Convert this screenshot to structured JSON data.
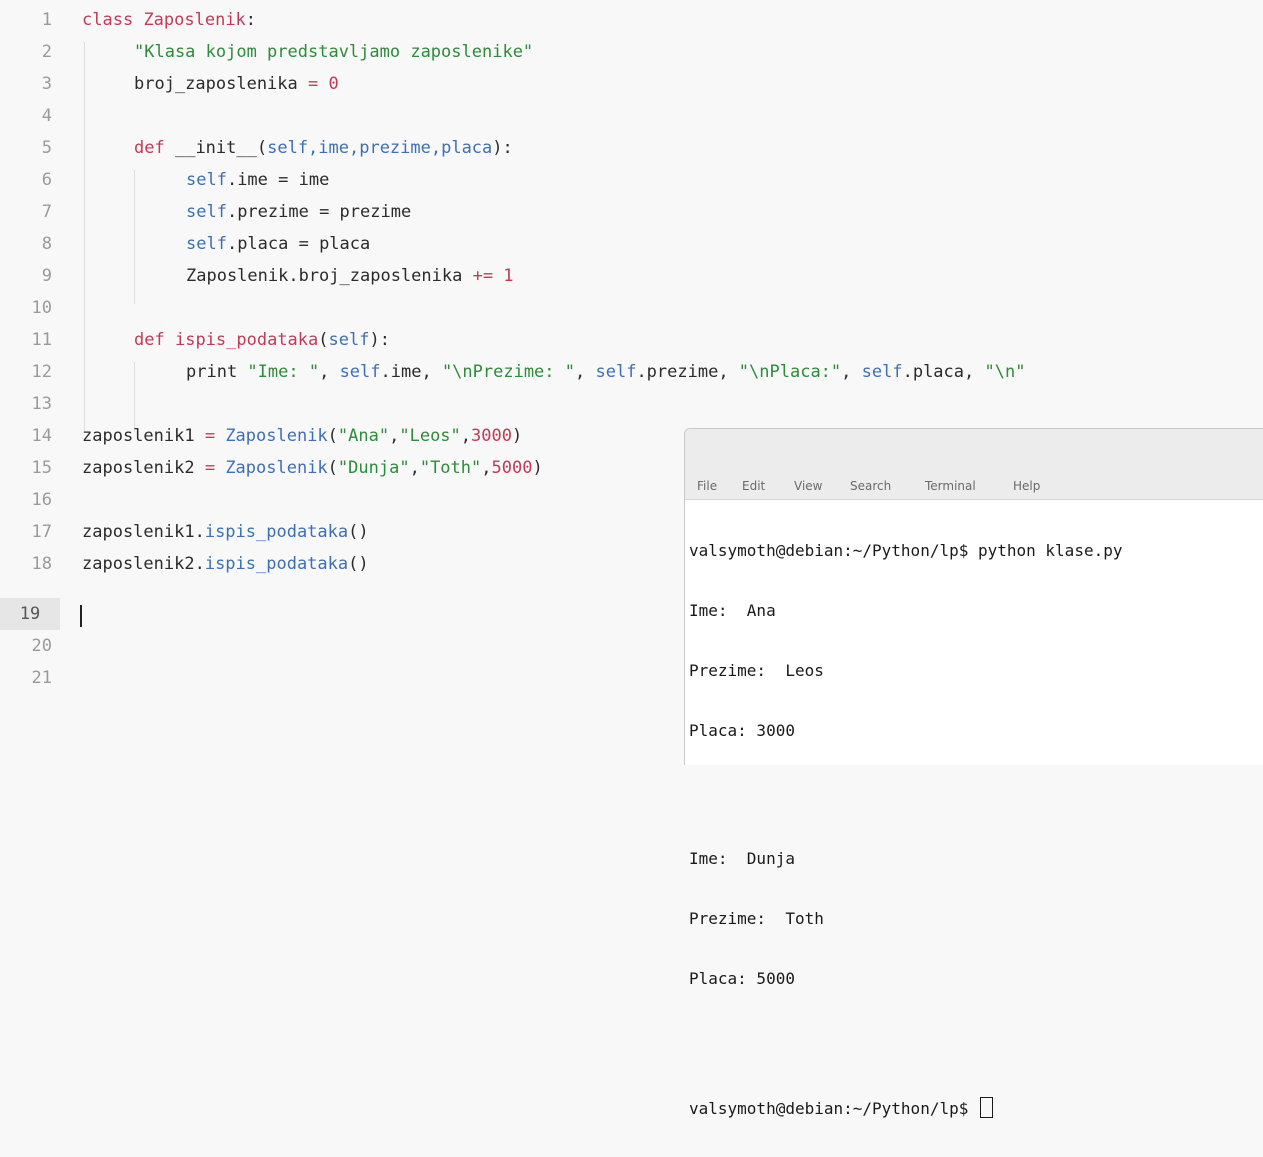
{
  "editor": {
    "line_numbers": [
      "1",
      "2",
      "3",
      "4",
      "5",
      "6",
      "7",
      "8",
      "9",
      "10",
      "11",
      "12",
      "13",
      "14",
      "15",
      "16",
      "17",
      "18",
      "19",
      "20",
      "21"
    ],
    "current_line": "19",
    "code": {
      "l1_kw": "class",
      "l1_cls": "Zaposlenik",
      "l1_colon": ":",
      "l2_str": "\"Klasa kojom predstavljamo zaposlenike\"",
      "l3_var": "broj_zaposlenika",
      "l3_op": " = ",
      "l3_num": "0",
      "l5_kw": "def",
      "l5_fn": "__init__",
      "l5_open": "(",
      "l5_params": "self,ime,prezime,placa",
      "l5_close": "):",
      "l6_self": "self",
      "l6_rest": ".ime = ime",
      "l7_self": "self",
      "l7_rest": ".prezime = prezime",
      "l8_self": "self",
      "l8_rest": ".placa = placa",
      "l9_a": "Zaposlenik.broj_zaposlenika ",
      "l9_op": "+=",
      "l9_num": " 1",
      "l11_kw": "def",
      "l11_fn": "ispis_podataka",
      "l11_open": "(",
      "l11_self": "self",
      "l11_close": "):",
      "l12_print": "print ",
      "l12_s1": "\"Ime: \"",
      "l12_c1": ", ",
      "l12_self1": "self",
      "l12_r1": ".ime, ",
      "l12_s2": "\"\\nPrezime: \"",
      "l12_c2": ", ",
      "l12_self2": "self",
      "l12_r2": ".prezime, ",
      "l12_s3": "\"\\nPlaca:\"",
      "l12_c3": ", ",
      "l12_self3": "self",
      "l12_r3": ".placa, ",
      "l12_s4": "\"\\n\"",
      "l14_var": "zaposlenik1",
      "l14_op": " = ",
      "l14_call": "Zaposlenik",
      "l14_open": "(",
      "l14_s1": "\"Ana\"",
      "l14_c1": ",",
      "l14_s2": "\"Leos\"",
      "l14_c2": ",",
      "l14_num": "3000",
      "l14_close": ")",
      "l15_var": "zaposlenik2",
      "l15_op": " = ",
      "l15_call": "Zaposlenik",
      "l15_open": "(",
      "l15_s1": "\"Dunja\"",
      "l15_c1": ",",
      "l15_s2": "\"Toth\"",
      "l15_c2": ",",
      "l15_num": "5000",
      "l15_close": ")",
      "l17_var": "zaposlenik1.",
      "l17_fn": "ispis_podataka",
      "l17_paren": "()",
      "l18_var": "zaposlenik2.",
      "l18_fn": "ispis_podataka",
      "l18_paren": "()"
    }
  },
  "terminal": {
    "menu": [
      "File",
      "Edit",
      "View",
      "Search",
      "Terminal",
      "Help"
    ],
    "lines": [
      "valsymoth@debian:~/Python/lp$ python klase.py",
      "Ime:  Ana",
      "Prezime:  Leos",
      "Placa: 3000",
      "",
      "Ime:  Dunja",
      "Prezime:  Toth",
      "Placa: 5000",
      "",
      "valsymoth@debian:~/Python/lp$ "
    ]
  }
}
